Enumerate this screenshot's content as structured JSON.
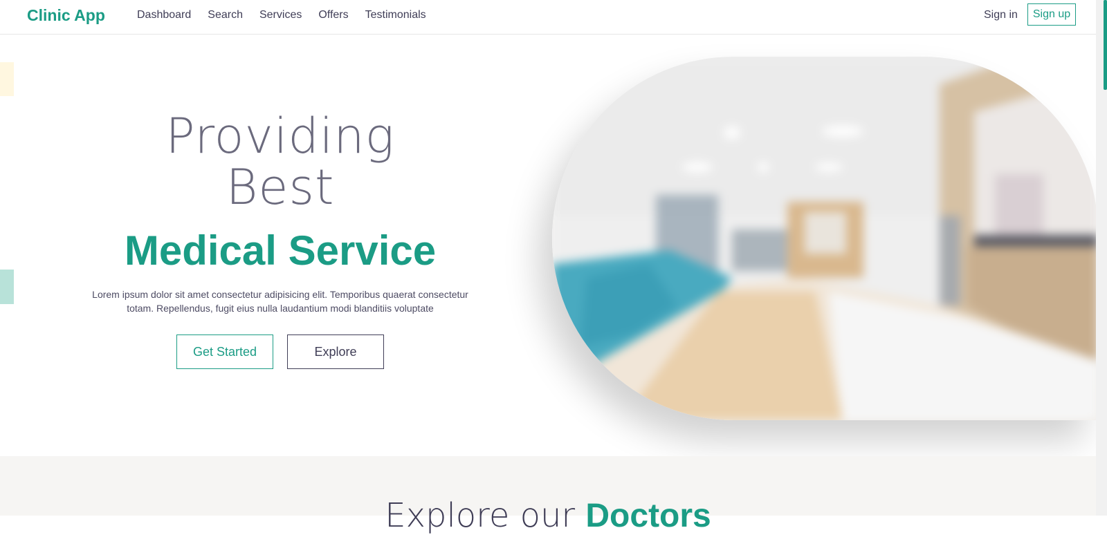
{
  "nav": {
    "brand": "Clinic App",
    "links": [
      "Dashboard",
      "Search",
      "Services",
      "Offers",
      "Testimonials"
    ],
    "sign_in": "Sign in",
    "sign_up": "Sign up"
  },
  "hero": {
    "line1": "Providing",
    "line2": "Best",
    "highlight": "Medical Service",
    "description": "Lorem ipsum dolor sit amet consectetur adipisicing elit. Temporibus quaerat consectetur totam. Repellendus, fugit eius nulla laudantium modi blanditiis voluptate",
    "primary_button": "Get Started",
    "secondary_button": "Explore"
  },
  "section2": {
    "title_light": "Explore our ",
    "title_bold": "Doctors"
  },
  "colors": {
    "brand": "#1b9c85",
    "text": "#3f3d56",
    "section_bg": "#f6f5f3"
  }
}
